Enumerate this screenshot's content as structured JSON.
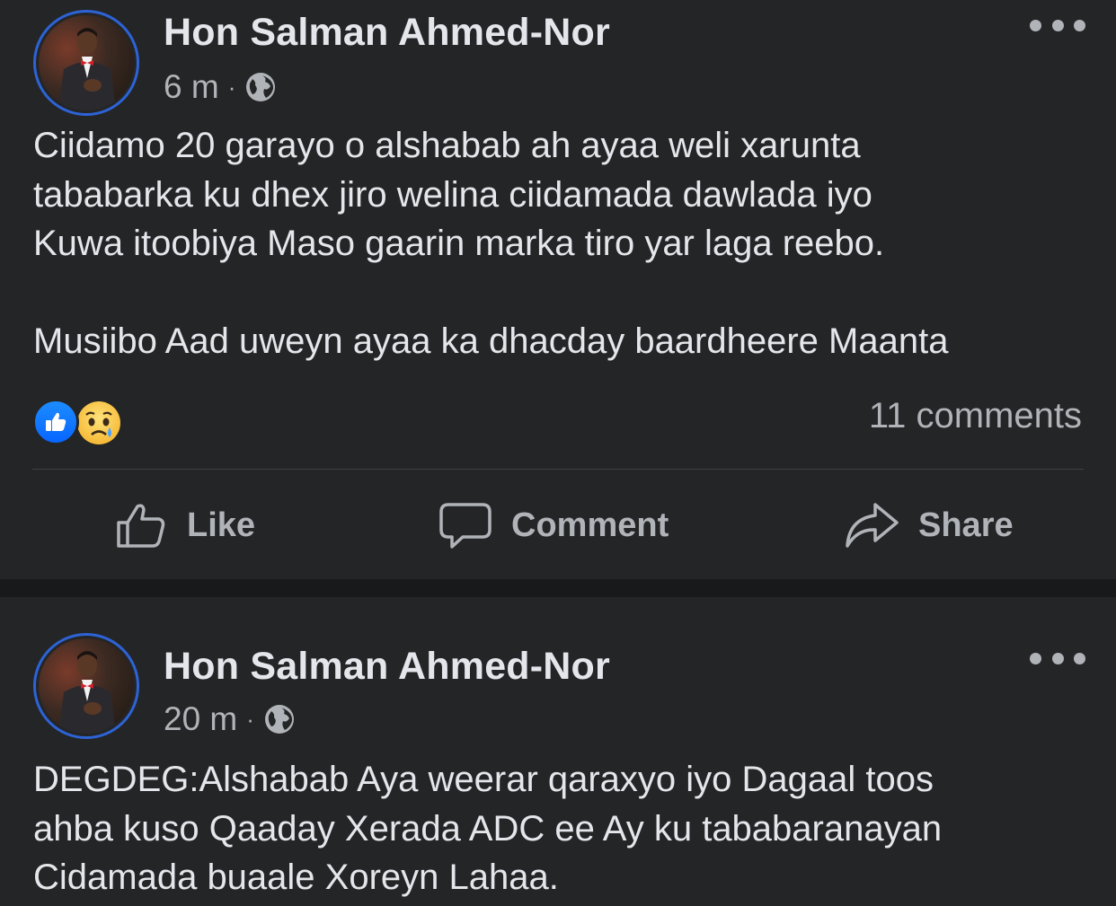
{
  "posts": [
    {
      "author": "Hon Salman Ahmed-Nor",
      "time": "6 m",
      "separator": "·",
      "visibility_icon": "globe-icon",
      "text": "Ciidamo 20 garayo o alshabab ah ayaa weli xarunta\ntababarka ku dhex jiro welina ciidamada dawlada iyo\nKuwa itoobiya Maso gaarin marka tiro yar laga reebo.\n\nMusiibo Aad uweyn ayaa ka dhacday baardheere Maanta",
      "reactions": [
        "like-reaction-icon",
        "sad-reaction-icon"
      ],
      "comments": "11 comments",
      "actions": {
        "like": "Like",
        "comment": "Comment",
        "share": "Share"
      }
    },
    {
      "author": "Hon Salman Ahmed-Nor",
      "time": "20 m",
      "separator": "·",
      "visibility_icon": "globe-icon",
      "text": "DEGDEG:Alshabab Aya weerar qaraxyo iyo Dagaal toos\nahba kuso Qaaday Xerada ADC ee Ay ku tababaranayan\nCidamada buaale Xoreyn Lahaa."
    }
  ],
  "colors": {
    "background": "#242526",
    "separator_band": "#18191a",
    "primary_text": "#e4e6eb",
    "secondary_text": "#b0b3b8",
    "avatar_ring": "#2d63d6",
    "like_blue": "#0866ff"
  }
}
